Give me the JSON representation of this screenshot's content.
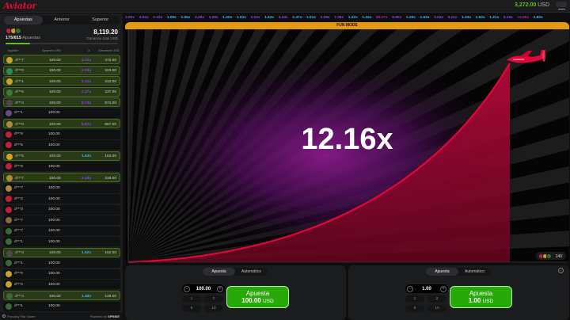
{
  "app": {
    "logo": "Aviator"
  },
  "balance": {
    "amount": "3,272.00",
    "currency": "USD"
  },
  "icons": {
    "menu": "hamburger-menu-icon",
    "history": "history-icon",
    "provably_fair": "shield-icon",
    "plane": "plane-icon"
  },
  "colors": {
    "accent_red": "#e50539",
    "win_green": "#28a909",
    "balance_green": "#5fc31a",
    "fun_mode": "#e59a13",
    "mult_blue": "#34b4ff",
    "mult_purple": "#913ef8",
    "mult_pink": "#c017b4"
  },
  "left_panel": {
    "tabs": [
      {
        "label": "Apuestas",
        "active": true
      },
      {
        "label": "Anterior",
        "active": false
      },
      {
        "label": "Superior",
        "active": false
      }
    ],
    "bets_count": "175/815",
    "bets_label": "Apuestas",
    "total_win": "8,119.20",
    "total_win_label": "Ganancia total USD",
    "progress_fraction": 0.215,
    "columns": {
      "player": "Jugador",
      "bet": "Apuesta USD",
      "mult": "X",
      "win": "Ganancia USD"
    },
    "rows": [
      {
        "user": "d***7",
        "bet": "100.00",
        "mult": "4.72x",
        "win": "472.00",
        "won": true,
        "color": "purple",
        "av": "#c7a12a"
      },
      {
        "user": "d***0",
        "bet": "100.00",
        "mult": "2.23x",
        "win": "223.00",
        "won": true,
        "color": "purple",
        "av": "#2a8d5c"
      },
      {
        "user": "d***1",
        "bet": "100.00",
        "mult": "3.12x",
        "win": "312.00",
        "won": true,
        "color": "purple",
        "av": "#c7a12a"
      },
      {
        "user": "d***6",
        "bet": "100.00",
        "mult": "2.37x",
        "win": "237.00",
        "won": true,
        "color": "purple",
        "av": "#3a7a3a"
      },
      {
        "user": "d***4",
        "bet": "100.00",
        "mult": "6.74x",
        "win": "674.00",
        "won": true,
        "color": "purple",
        "av": "#4a4a4a"
      },
      {
        "user": "d***1",
        "bet": "100.00",
        "mult": "",
        "win": "",
        "won": false,
        "color": "",
        "av": "#6a4a8a"
      },
      {
        "user": "d***0",
        "bet": "100.00",
        "mult": "5.57x",
        "win": "557.00",
        "won": true,
        "color": "purple",
        "av": "#b08a3a"
      },
      {
        "user": "d***8",
        "bet": "100.00",
        "mult": "",
        "win": "",
        "won": false,
        "color": "",
        "av": "#c0203a"
      },
      {
        "user": "d***5",
        "bet": "100.00",
        "mult": "",
        "win": "",
        "won": false,
        "color": "",
        "av": "#c0203a"
      },
      {
        "user": "d***5",
        "bet": "100.00",
        "mult": "1.63x",
        "win": "163.00",
        "won": true,
        "color": "blue",
        "av": "#d8a020"
      },
      {
        "user": "d***9",
        "bet": "100.00",
        "mult": "",
        "win": "",
        "won": false,
        "color": "",
        "av": "#c0203a"
      },
      {
        "user": "d***7",
        "bet": "100.00",
        "mult": "3.18x",
        "win": "318.00",
        "won": true,
        "color": "purple",
        "av": "#b08a3a"
      },
      {
        "user": "d***7",
        "bet": "100.00",
        "mult": "",
        "win": "",
        "won": false,
        "color": "",
        "av": "#b08a3a"
      },
      {
        "user": "d***2",
        "bet": "100.00",
        "mult": "",
        "win": "",
        "won": false,
        "color": "",
        "av": "#c0203a"
      },
      {
        "user": "d***3",
        "bet": "100.00",
        "mult": "",
        "win": "",
        "won": false,
        "color": "",
        "av": "#c0203a"
      },
      {
        "user": "d***7",
        "bet": "100.00",
        "mult": "",
        "win": "",
        "won": false,
        "color": "",
        "av": "#8a6a3a"
      },
      {
        "user": "d***7",
        "bet": "100.00",
        "mult": "",
        "win": "",
        "won": false,
        "color": "",
        "av": "#3a6a3a"
      },
      {
        "user": "d***1",
        "bet": "100.00",
        "mult": "",
        "win": "",
        "won": false,
        "color": "",
        "av": "#3a6a3a"
      },
      {
        "user": "d***4",
        "bet": "100.00",
        "mult": "1.52x",
        "win": "152.00",
        "won": true,
        "color": "blue",
        "av": "#4a4a4a"
      },
      {
        "user": "d***1",
        "bet": "100.00",
        "mult": "",
        "win": "",
        "won": false,
        "color": "",
        "av": "#3a6a3a"
      },
      {
        "user": "d***6",
        "bet": "100.00",
        "mult": "",
        "win": "",
        "won": false,
        "color": "",
        "av": "#c7a12a"
      },
      {
        "user": "d***4",
        "bet": "100.00",
        "mult": "",
        "win": "",
        "won": false,
        "color": "",
        "av": "#c7a12a"
      },
      {
        "user": "d***3",
        "bet": "100.00",
        "mult": "1.48x",
        "win": "148.00",
        "won": true,
        "color": "blue",
        "av": "#3a6a3a"
      },
      {
        "user": "d***1",
        "bet": "100.00",
        "mult": "",
        "win": "",
        "won": false,
        "color": "",
        "av": "#3a6a3a"
      }
    ],
    "footer": {
      "provably_fair": "Provably Fair Game",
      "powered_by": "Powered by",
      "brand": "SPRIBE"
    }
  },
  "history": [
    {
      "v": "2.93x",
      "c": "purple"
    },
    {
      "v": "4.04x",
      "c": "purple"
    },
    {
      "v": "2.43x",
      "c": "purple"
    },
    {
      "v": "1.05x",
      "c": "blue"
    },
    {
      "v": "1.65x",
      "c": "blue"
    },
    {
      "v": "3.48x",
      "c": "purple"
    },
    {
      "v": "3.39x",
      "c": "purple"
    },
    {
      "v": "1.30x",
      "c": "blue"
    },
    {
      "v": "1.03x",
      "c": "blue"
    },
    {
      "v": "3.03x",
      "c": "purple"
    },
    {
      "v": "1.63x",
      "c": "blue"
    },
    {
      "v": "4.34x",
      "c": "purple"
    },
    {
      "v": "1.47x",
      "c": "blue"
    },
    {
      "v": "1.01x",
      "c": "blue"
    },
    {
      "v": "3.08x",
      "c": "purple"
    },
    {
      "v": "7.36x",
      "c": "purple"
    },
    {
      "v": "1.32x",
      "c": "blue"
    },
    {
      "v": "1.24x",
      "c": "blue"
    },
    {
      "v": "89.27x",
      "c": "pink"
    },
    {
      "v": "5.80x",
      "c": "purple"
    },
    {
      "v": "1.29x",
      "c": "blue"
    },
    {
      "v": "1.63x",
      "c": "blue"
    },
    {
      "v": "3.04x",
      "c": "purple"
    },
    {
      "v": "5.11x",
      "c": "purple"
    },
    {
      "v": "1.33x",
      "c": "blue"
    },
    {
      "v": "1.53x",
      "c": "blue"
    },
    {
      "v": "1.21x",
      "c": "blue"
    },
    {
      "v": "5.33x",
      "c": "purple"
    },
    {
      "v": "12.85x",
      "c": "pink"
    },
    {
      "v": "1.82x",
      "c": "blue"
    }
  ],
  "game": {
    "fun_mode": "FUN MODE",
    "multiplier": "12.16x",
    "online_count": "140"
  },
  "bet_panels": [
    {
      "tabs": [
        "Apuesta",
        "Automático"
      ],
      "active_tab": 0,
      "amount": "100.00",
      "quick": [
        "1",
        "2",
        "5",
        "10"
      ],
      "button_label": "Apuesta",
      "button_amount": "100.00",
      "button_currency": "USD",
      "closable": false
    },
    {
      "tabs": [
        "Apuesta",
        "Automático"
      ],
      "active_tab": 0,
      "amount": "1.00",
      "quick": [
        "1",
        "2",
        "5",
        "10"
      ],
      "button_label": "Apuesta",
      "button_amount": "1.00",
      "button_currency": "USD",
      "closable": true
    }
  ]
}
